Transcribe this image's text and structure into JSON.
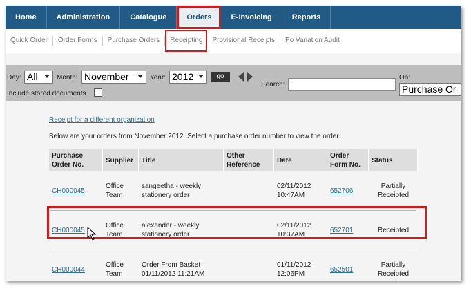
{
  "nav": {
    "items": [
      {
        "label": "Home"
      },
      {
        "label": "Administration"
      },
      {
        "label": "Catalogue"
      },
      {
        "label": "Orders"
      },
      {
        "label": "E-Invoicing"
      },
      {
        "label": "Reports"
      }
    ],
    "active_index": 3
  },
  "subnav": {
    "items": [
      {
        "label": "Quick Order"
      },
      {
        "label": "Order Forms"
      },
      {
        "label": "Purchase Orders"
      },
      {
        "label": "Receipting"
      },
      {
        "label": "Provisional Receipts"
      },
      {
        "label": "Po Variation Audit"
      }
    ],
    "active_index": 3
  },
  "filters": {
    "day_label": "Day:",
    "day_value": "All",
    "month_label": "Month:",
    "month_value": "November",
    "year_label": "Year:",
    "year_value": "2012",
    "go_label": "go",
    "include_label": "Include stored documents",
    "search_label": "Search:",
    "search_value": "",
    "on_label": "On:",
    "on_value": "Purchase Or"
  },
  "content": {
    "org_link": "Receipt for a different organization",
    "intro": "Below are your orders from November 2012. Select a purchase order number to view the order."
  },
  "table": {
    "headers": {
      "po": "Purchase Order No.",
      "supplier": "Supplier",
      "title": "Title",
      "other_ref": "Other Reference",
      "date": "Date",
      "order_form": "Order Form No.",
      "status": "Status"
    },
    "rows": [
      {
        "po": "CH000045",
        "supplier": "Office Team",
        "title": "sangeetha - weekly stationery order",
        "other_ref": "",
        "date": "02/11/2012 10:47AM",
        "order_form": "652706",
        "status": "Partially Receipted"
      },
      {
        "po": "CH000045",
        "supplier": "Office Team",
        "title": "alexander - weekly stationery order",
        "other_ref": "",
        "date": "02/11/2012 10:37AM",
        "order_form": "652701",
        "status": "Receipted"
      },
      {
        "po": "CH000044",
        "supplier": "Office Team",
        "title": "Order From Basket 01/11/2012 11:21AM",
        "other_ref": "",
        "date": "01/11/2012 12:06PM",
        "order_form": "652501",
        "status": "Partially Receipted"
      }
    ]
  },
  "colors": {
    "nav_bg": "#215a84",
    "highlight": "#d01c1c",
    "link": "#2a6f9a",
    "filter_bg": "#bdbdbd"
  }
}
